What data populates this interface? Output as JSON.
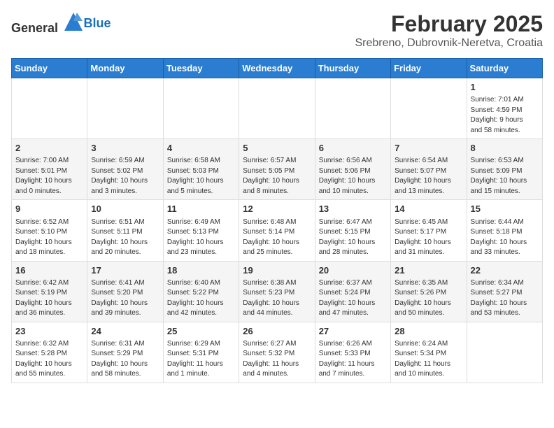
{
  "header": {
    "logo_general": "General",
    "logo_blue": "Blue",
    "month": "February 2025",
    "location": "Srebreno, Dubrovnik-Neretva, Croatia"
  },
  "weekdays": [
    "Sunday",
    "Monday",
    "Tuesday",
    "Wednesday",
    "Thursday",
    "Friday",
    "Saturday"
  ],
  "weeks": [
    [
      {
        "day": "",
        "info": ""
      },
      {
        "day": "",
        "info": ""
      },
      {
        "day": "",
        "info": ""
      },
      {
        "day": "",
        "info": ""
      },
      {
        "day": "",
        "info": ""
      },
      {
        "day": "",
        "info": ""
      },
      {
        "day": "1",
        "info": "Sunrise: 7:01 AM\nSunset: 4:59 PM\nDaylight: 9 hours\nand 58 minutes."
      }
    ],
    [
      {
        "day": "2",
        "info": "Sunrise: 7:00 AM\nSunset: 5:01 PM\nDaylight: 10 hours\nand 0 minutes."
      },
      {
        "day": "3",
        "info": "Sunrise: 6:59 AM\nSunset: 5:02 PM\nDaylight: 10 hours\nand 3 minutes."
      },
      {
        "day": "4",
        "info": "Sunrise: 6:58 AM\nSunset: 5:03 PM\nDaylight: 10 hours\nand 5 minutes."
      },
      {
        "day": "5",
        "info": "Sunrise: 6:57 AM\nSunset: 5:05 PM\nDaylight: 10 hours\nand 8 minutes."
      },
      {
        "day": "6",
        "info": "Sunrise: 6:56 AM\nSunset: 5:06 PM\nDaylight: 10 hours\nand 10 minutes."
      },
      {
        "day": "7",
        "info": "Sunrise: 6:54 AM\nSunset: 5:07 PM\nDaylight: 10 hours\nand 13 minutes."
      },
      {
        "day": "8",
        "info": "Sunrise: 6:53 AM\nSunset: 5:09 PM\nDaylight: 10 hours\nand 15 minutes."
      }
    ],
    [
      {
        "day": "9",
        "info": "Sunrise: 6:52 AM\nSunset: 5:10 PM\nDaylight: 10 hours\nand 18 minutes."
      },
      {
        "day": "10",
        "info": "Sunrise: 6:51 AM\nSunset: 5:11 PM\nDaylight: 10 hours\nand 20 minutes."
      },
      {
        "day": "11",
        "info": "Sunrise: 6:49 AM\nSunset: 5:13 PM\nDaylight: 10 hours\nand 23 minutes."
      },
      {
        "day": "12",
        "info": "Sunrise: 6:48 AM\nSunset: 5:14 PM\nDaylight: 10 hours\nand 25 minutes."
      },
      {
        "day": "13",
        "info": "Sunrise: 6:47 AM\nSunset: 5:15 PM\nDaylight: 10 hours\nand 28 minutes."
      },
      {
        "day": "14",
        "info": "Sunrise: 6:45 AM\nSunset: 5:17 PM\nDaylight: 10 hours\nand 31 minutes."
      },
      {
        "day": "15",
        "info": "Sunrise: 6:44 AM\nSunset: 5:18 PM\nDaylight: 10 hours\nand 33 minutes."
      }
    ],
    [
      {
        "day": "16",
        "info": "Sunrise: 6:42 AM\nSunset: 5:19 PM\nDaylight: 10 hours\nand 36 minutes."
      },
      {
        "day": "17",
        "info": "Sunrise: 6:41 AM\nSunset: 5:20 PM\nDaylight: 10 hours\nand 39 minutes."
      },
      {
        "day": "18",
        "info": "Sunrise: 6:40 AM\nSunset: 5:22 PM\nDaylight: 10 hours\nand 42 minutes."
      },
      {
        "day": "19",
        "info": "Sunrise: 6:38 AM\nSunset: 5:23 PM\nDaylight: 10 hours\nand 44 minutes."
      },
      {
        "day": "20",
        "info": "Sunrise: 6:37 AM\nSunset: 5:24 PM\nDaylight: 10 hours\nand 47 minutes."
      },
      {
        "day": "21",
        "info": "Sunrise: 6:35 AM\nSunset: 5:26 PM\nDaylight: 10 hours\nand 50 minutes."
      },
      {
        "day": "22",
        "info": "Sunrise: 6:34 AM\nSunset: 5:27 PM\nDaylight: 10 hours\nand 53 minutes."
      }
    ],
    [
      {
        "day": "23",
        "info": "Sunrise: 6:32 AM\nSunset: 5:28 PM\nDaylight: 10 hours\nand 55 minutes."
      },
      {
        "day": "24",
        "info": "Sunrise: 6:31 AM\nSunset: 5:29 PM\nDaylight: 10 hours\nand 58 minutes."
      },
      {
        "day": "25",
        "info": "Sunrise: 6:29 AM\nSunset: 5:31 PM\nDaylight: 11 hours\nand 1 minute."
      },
      {
        "day": "26",
        "info": "Sunrise: 6:27 AM\nSunset: 5:32 PM\nDaylight: 11 hours\nand 4 minutes."
      },
      {
        "day": "27",
        "info": "Sunrise: 6:26 AM\nSunset: 5:33 PM\nDaylight: 11 hours\nand 7 minutes."
      },
      {
        "day": "28",
        "info": "Sunrise: 6:24 AM\nSunset: 5:34 PM\nDaylight: 11 hours\nand 10 minutes."
      },
      {
        "day": "",
        "info": ""
      }
    ]
  ]
}
